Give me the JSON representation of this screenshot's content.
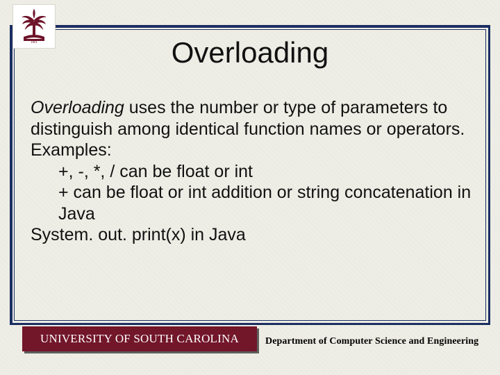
{
  "title": "Overloading",
  "body": {
    "definition_lead": "Overloading",
    "definition_rest": " uses the number or type of parameters to distinguish among identical function names or operators.",
    "examples_label": "Examples:",
    "example1": "+, -, *, /  can be float or int",
    "example2": "+ can be float or int addition or string concatenation in Java",
    "example3": "System. out. print(x) in Java"
  },
  "footer": {
    "left": "UNIVERSITY OF SOUTH CAROLINA",
    "right": "Department of Computer Science and Engineering"
  }
}
